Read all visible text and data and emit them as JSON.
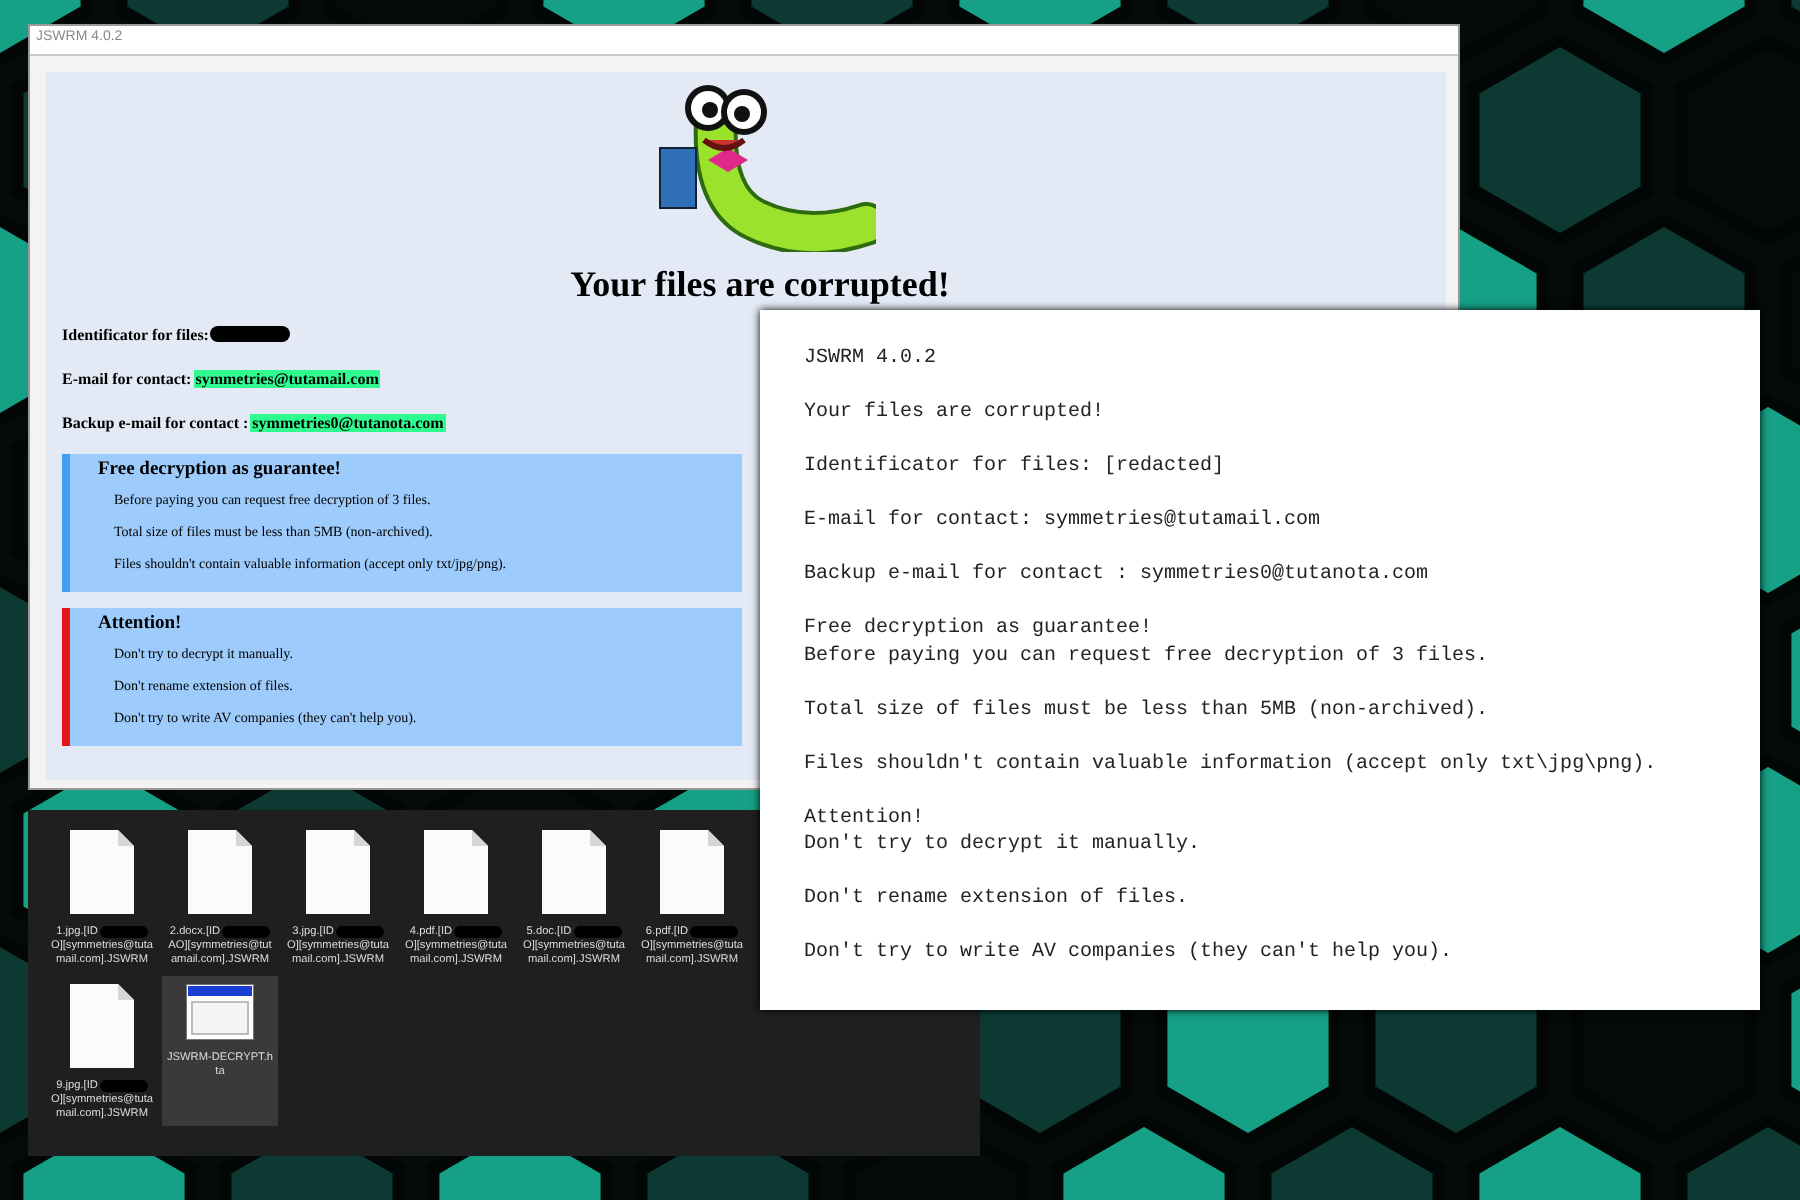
{
  "hta_window": {
    "title": "JSWRM 4.0.2",
    "heading": "Your files are corrupted!",
    "fields": [
      {
        "kind": "redacted",
        "label": "Identificator for files:"
      },
      {
        "kind": "email",
        "label": "E-mail for contact:",
        "value": "symmetries@tutamail.com"
      },
      {
        "kind": "email",
        "label": "Backup e-mail for contact :",
        "value": "symmetries0@tutanota.com"
      }
    ],
    "boxes": [
      {
        "title": "Free decryption as guarantee!",
        "color": "#3f9ff0",
        "lines": [
          "Before paying you can request free decryption of 3 files.",
          "Total size of files must be less than 5MB (non-archived).",
          "Files shouldn't contain valuable information (accept only txt/jpg/png)."
        ]
      },
      {
        "title": "Attention!",
        "color": "#e5141c",
        "lines": [
          "Don't try to decrypt it manually.",
          "Don't rename extension of files.",
          "Don't try to write AV companies (they can't help you)."
        ]
      }
    ]
  },
  "notepad": {
    "paragraphs": [
      [
        "JSWRM 4.0.2"
      ],
      [
        "Your files are corrupted!"
      ],
      [
        "Identificator for files: [redacted]"
      ],
      [
        "E-mail for contact: symmetries@tutamail.com"
      ],
      [
        "Backup e-mail for contact : symmetries0@tutanota.com"
      ],
      [
        "Free decryption as guarantee!",
        "Before paying you can request free decryption of 3 files."
      ],
      [
        "Total size of files must be less than 5MB (non-archived)."
      ],
      [
        "Files shouldn't contain valuable information (accept only txt\\jpg\\png)."
      ],
      [
        "Attention!",
        "Don't try to decrypt it manually."
      ],
      [
        "Don't rename extension of files."
      ],
      [
        "Don't try to write AV companies (they can't help you)."
      ]
    ]
  },
  "explorer": {
    "rows": [
      [
        {
          "kind": "document",
          "selected": false,
          "name_start": "1.jpg.[ID",
          "name_end": "O][symmetries@tutamail.com].JSWRM"
        },
        {
          "kind": "document",
          "selected": false,
          "name_start": "2.docx.[ID",
          "name_end": "AO][symmetries@tutamail.com].JSWRM"
        },
        {
          "kind": "document",
          "selected": false,
          "name_start": "3.jpg.[ID",
          "name_end": "O][symmetries@tutamail.com].JSWRM"
        },
        {
          "kind": "document",
          "selected": false,
          "name_start": "4.pdf.[ID",
          "name_end": "O][symmetries@tutamail.com].JSWRM"
        },
        {
          "kind": "document",
          "selected": false,
          "name_start": "5.doc.[ID",
          "name_end": "O][symmetries@tutamail.com].JSWRM"
        },
        {
          "kind": "document",
          "selected": false,
          "name_start": "6.pdf.[ID",
          "name_end": "O][symmetries@tutamail.com].JSWRM"
        }
      ],
      [
        {
          "kind": "document",
          "selected": false,
          "name_start": "9.jpg.[ID",
          "name_end": "O][symmetries@tutamail.com].JSWRM"
        },
        {
          "kind": "application",
          "selected": true,
          "name_start": "JSWRM-DECRYPT.hta"
        }
      ]
    ]
  }
}
